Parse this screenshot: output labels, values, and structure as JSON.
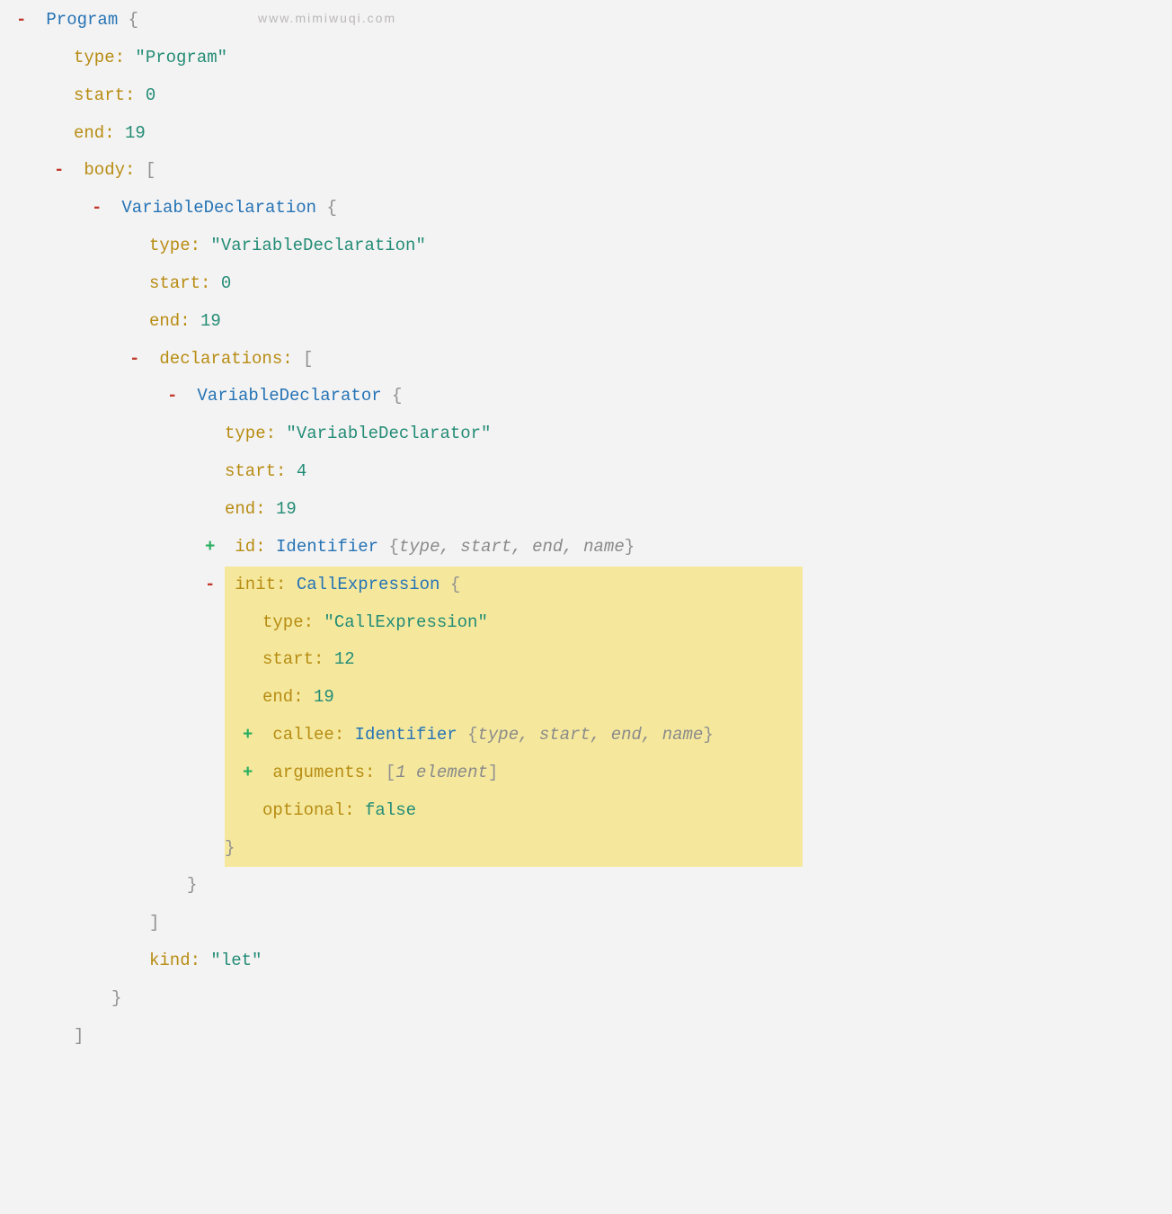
{
  "watermark": "www.mimiwuqi.com",
  "tree": {
    "root": {
      "name": "Program",
      "brace_open": "{",
      "type_label": "type",
      "type_value": "\"Program\"",
      "start_label": "start",
      "start_value": "0",
      "end_label": "end",
      "end_value": "19",
      "body_label": "body",
      "bracket_open": "[",
      "child": {
        "name": "VariableDeclaration",
        "brace_open": "{",
        "type_label": "type",
        "type_value": "\"VariableDeclaration\"",
        "start_label": "start",
        "start_value": "0",
        "end_label": "end",
        "end_value": "19",
        "decl_label": "declarations",
        "bracket_open": "[",
        "kind_label": "kind",
        "kind_value": "\"let\"",
        "child": {
          "name": "VariableDeclarator",
          "brace_open": "{",
          "type_label": "type",
          "type_value": "\"VariableDeclarator\"",
          "start_label": "start",
          "start_value": "4",
          "end_label": "end",
          "end_value": "19",
          "id_label": "id",
          "id_type": "Identifier",
          "id_summary_open": "{",
          "id_summary": "type, start, end, name",
          "id_summary_close": "}",
          "init_label": "init",
          "init_type": "CallExpression",
          "init": {
            "brace_open": "{",
            "type_label": "type",
            "type_value": "\"CallExpression\"",
            "start_label": "start",
            "start_value": "12",
            "end_label": "end",
            "end_value": "19",
            "callee_label": "callee",
            "callee_type": "Identifier",
            "callee_summary_open": "{",
            "callee_summary": "type, start, end, name",
            "callee_summary_close": "}",
            "args_label": "arguments",
            "args_bracket_open": "[",
            "args_summary": "1 element",
            "args_bracket_close": "]",
            "optional_label": "optional",
            "optional_value": "false",
            "brace_close": "}"
          },
          "brace_close": "}"
        },
        "bracket_close": "]",
        "brace_close": "}"
      },
      "bracket_close": "]"
    }
  },
  "punc": {
    "colon": ":"
  }
}
